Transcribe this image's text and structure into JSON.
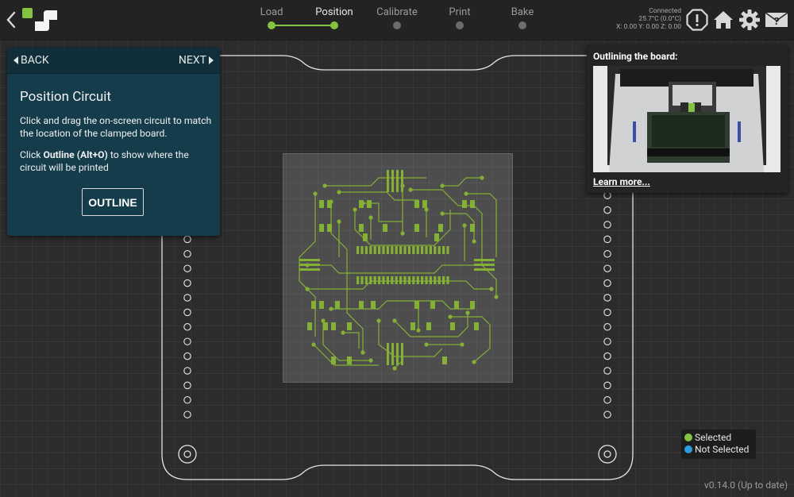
{
  "steps": [
    {
      "label": "Load",
      "state": "done"
    },
    {
      "label": "Position",
      "state": "active"
    },
    {
      "label": "Calibrate",
      "state": "pending"
    },
    {
      "label": "Print",
      "state": "pending"
    },
    {
      "label": "Bake",
      "state": "pending"
    }
  ],
  "status": {
    "connection": "Connected",
    "temperature": "25.7°C (0.0°C)",
    "position": "X: 0.00 Y: 0.00 Z: 0.00"
  },
  "header_icons": [
    "alert-icon",
    "home-icon",
    "gear-icon",
    "help-icon"
  ],
  "panel": {
    "back_label": "BACK",
    "next_label": "NEXT",
    "title": "Position Circuit",
    "instruction1": "Click and drag the on-screen circuit to match the location of the clamped board.",
    "instruction2_pre": "Click ",
    "instruction2_bold": "Outline (Alt+O)",
    "instruction2_post": " to show where the circuit will be printed",
    "outline_button": "OUTLINE"
  },
  "video": {
    "title": "Outlining the board:",
    "link": "Learn more..."
  },
  "legend": {
    "selected_label": "Selected",
    "not_selected_label": "Not Selected"
  },
  "colors": {
    "accent_green": "#84c341",
    "panel_teal": "#153c4a",
    "selected": "#84c341",
    "not_selected": "#2e9be0",
    "trace": "#84b036"
  },
  "version": "v0.14.0 (Up to date)"
}
